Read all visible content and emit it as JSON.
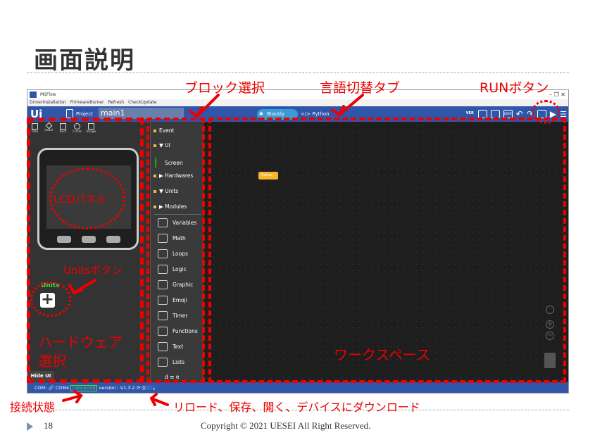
{
  "slide": {
    "title": "画面説明",
    "page_number": "18",
    "copyright": "Copyright © 2021 UESEI All Right Reserved."
  },
  "window": {
    "title": "MSFlow",
    "controls": "–  ❐  ✕"
  },
  "menu": [
    "DriverInstallation",
    "FirmwareBurner",
    "Refresh",
    "CheckUpdate"
  ],
  "toolbar": {
    "logo": "Ui",
    "project_label": "Project",
    "file_name": "main1",
    "tab_blockly": "Blockly",
    "tab_python": "</> Python",
    "icons": [
      "VER",
      "code",
      "save",
      "DEMO",
      "undo",
      "redo",
      "device",
      "run",
      "menu"
    ]
  },
  "shapes": [
    "Title",
    "Label",
    "Rect",
    "Circle",
    "Image"
  ],
  "left_panel": {
    "units_label": "Units",
    "units_button": "+",
    "hide_ui": "Hide UI"
  },
  "blocks": {
    "categories": [
      {
        "label": "Event",
        "color": "#e8c040"
      },
      {
        "label": "▼ UI",
        "color": "#e8c040"
      },
      {
        "label": "Screen",
        "color": "#22aa22"
      },
      {
        "label": "▶ Hardwares",
        "color": "#e8c040"
      },
      {
        "label": "▼ Units",
        "color": "#e8c040"
      },
      {
        "label": "▶ Modules",
        "color": "#e8c040"
      }
    ],
    "items": [
      "Variables",
      "Math",
      "Loops",
      "Logic",
      "Graphic",
      "Emoji",
      "Timer",
      "Functions",
      "Text",
      "Lists"
    ],
    "more": "d  ≡  e"
  },
  "workspace": {
    "setup_label": "Setup"
  },
  "status": {
    "com": "COM: 🔗 COM4",
    "connected": "Connected",
    "version": "version : V1.3.2",
    "icons": "⟳ 🖫 🗀 ⤓"
  },
  "annotations": {
    "block_select": "ブロック選択",
    "lang_tab": "言語切替タブ",
    "run_button": "RUNボタン",
    "lcd_panel": "LCDパネル",
    "units_button": "Unitsボタン",
    "hardware_select_1": "ハードウェア",
    "hardware_select_2": "選択",
    "workspace": "ワークスペース",
    "connection": "接続状態",
    "reload": "リロード、保存、開く、デバイスにダウンロード"
  }
}
